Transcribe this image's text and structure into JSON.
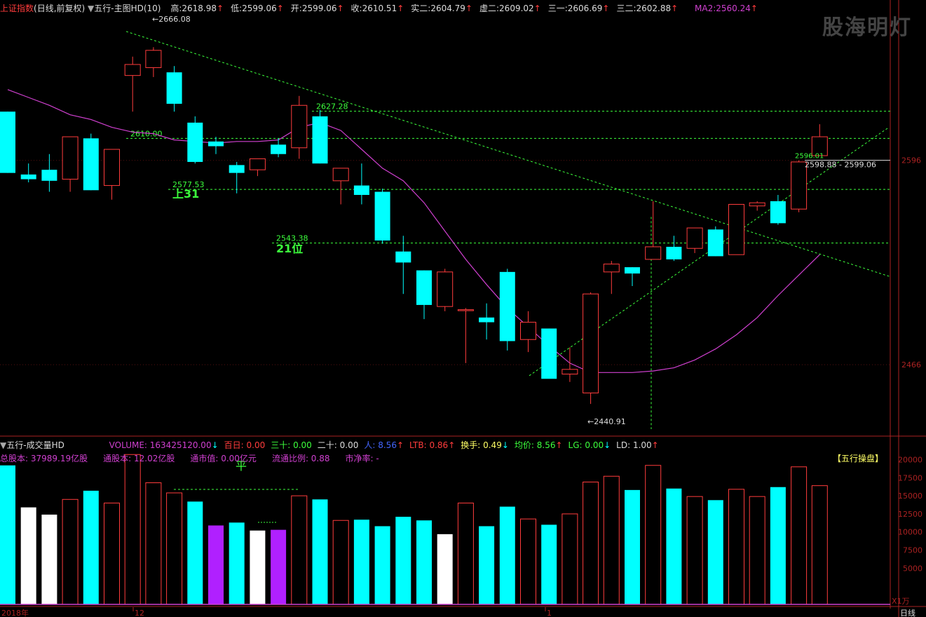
{
  "colors": {
    "up": "#ff3c3c",
    "down": "#00ffff",
    "ma": "#d040d0",
    "guide": "#3cff3c",
    "white": "#ffffff",
    "purple": "#b020ff",
    "axis": "#aa2222"
  },
  "header": {
    "index_name": "上证指数",
    "mode": "(日线,前复权)",
    "indicator": "五行-主图HD(10)",
    "quotes": [
      {
        "label": "高:",
        "value": "2618.98"
      },
      {
        "label": "低:",
        "value": "2599.06"
      },
      {
        "label": "开:",
        "value": "2599.06"
      },
      {
        "label": "收:",
        "value": "2610.51"
      },
      {
        "label": "实二:",
        "value": "2604.79"
      },
      {
        "label": "虚二:",
        "value": "2609.02"
      },
      {
        "label": "三一:",
        "value": "2606.69"
      },
      {
        "label": "三二:",
        "value": "2602.88"
      }
    ],
    "ma2_label": "MA2:",
    "ma2_value": "2560.24"
  },
  "watermark": "股海明灯",
  "annotations": {
    "top_high": "2666.08",
    "low_point": "2440.91",
    "level_2610": "2610.00",
    "level_2627": "2627.28",
    "level_2577": "2577.53",
    "level_2543": "2543.38",
    "tag_up31": "上31",
    "tag_21": "21位",
    "last_price": "2596.01",
    "last_range": "2598.88 - 2599.06"
  },
  "price_axis": [
    "2596",
    "2466"
  ],
  "volume_header": {
    "title": "五行-成交量HD",
    "items": [
      {
        "label": "VOLUME: ",
        "value": "163425120.00",
        "arrow": "↓"
      },
      {
        "label": "百日: ",
        "value": "0.00",
        "arrow": ""
      },
      {
        "label": "三十: ",
        "value": "0.00",
        "arrow": ""
      },
      {
        "label": "二十: ",
        "value": "0.00",
        "arrow": ""
      },
      {
        "label": "人: ",
        "value": "8.56",
        "arrow": "↑"
      },
      {
        "label": "LTB: ",
        "value": "0.86",
        "arrow": "↑"
      },
      {
        "label": "换手: ",
        "value": "0.49",
        "arrow": "↓"
      },
      {
        "label": "均价: ",
        "value": "8.56",
        "arrow": "↑"
      },
      {
        "label": "LG: ",
        "value": "0.00",
        "arrow": "↓"
      },
      {
        "label": "LD: ",
        "value": "1.00",
        "arrow": "↑"
      }
    ],
    "line2": [
      {
        "label": "总股本: ",
        "value": "37989.19亿股"
      },
      {
        "label": "通股本: ",
        "value": "12.02亿股"
      },
      {
        "label": "通市值: ",
        "value": "0.00亿元"
      },
      {
        "label": "流通比例: ",
        "value": "0.88"
      },
      {
        "label": "市净率: ",
        "value": "-"
      }
    ],
    "flat_tag": "平",
    "badge": "【五行操盘】"
  },
  "volume_axis": [
    "20000",
    "17500",
    "15000",
    "12500",
    "10000",
    "7500",
    "5000"
  ],
  "volume_unit": "X1万",
  "date_labels": [
    "2018年",
    "12",
    "1"
  ],
  "period": "日线",
  "chart_data": [
    {
      "type": "candlestick",
      "title": "上证指数 (日线,前复权)",
      "xlabel": "",
      "ylabel": "",
      "ylim": [
        2425,
        2690
      ],
      "candles": [
        {
          "o": 2627,
          "h": 2627,
          "l": 2588,
          "c": 2588,
          "dir": "down"
        },
        {
          "o": 2587,
          "h": 2594,
          "l": 2582,
          "c": 2584,
          "dir": "down"
        },
        {
          "o": 2590,
          "h": 2600,
          "l": 2576,
          "c": 2583,
          "dir": "down"
        },
        {
          "o": 2584,
          "h": 2610,
          "l": 2576,
          "c": 2611,
          "dir": "up"
        },
        {
          "o": 2610,
          "h": 2613,
          "l": 2577,
          "c": 2577,
          "dir": "down"
        },
        {
          "o": 2580,
          "h": 2595,
          "l": 2571,
          "c": 2603,
          "dir": "up"
        },
        {
          "o": 2650,
          "h": 2662,
          "l": 2627,
          "c": 2657,
          "dir": "up"
        },
        {
          "o": 2655,
          "h": 2668,
          "l": 2649,
          "c": 2666,
          "dir": "up"
        },
        {
          "o": 2652,
          "h": 2656,
          "l": 2627,
          "c": 2632,
          "dir": "down"
        },
        {
          "o": 2620,
          "h": 2624,
          "l": 2594,
          "c": 2595,
          "dir": "down"
        },
        {
          "o": 2608,
          "h": 2611,
          "l": 2600,
          "c": 2605,
          "dir": "down"
        },
        {
          "o": 2593,
          "h": 2595,
          "l": 2575,
          "c": 2588,
          "dir": "down"
        },
        {
          "o": 2590,
          "h": 2597,
          "l": 2586,
          "c": 2597,
          "dir": "up"
        },
        {
          "o": 2606,
          "h": 2610,
          "l": 2598,
          "c": 2600,
          "dir": "down"
        },
        {
          "o": 2604,
          "h": 2637,
          "l": 2597,
          "c": 2631,
          "dir": "up"
        },
        {
          "o": 2624,
          "h": 2628,
          "l": 2594,
          "c": 2594,
          "dir": "down"
        },
        {
          "o": 2591,
          "h": 2591,
          "l": 2568,
          "c": 2583,
          "dir": "up"
        },
        {
          "o": 2580,
          "h": 2594,
          "l": 2568,
          "c": 2574,
          "dir": "down"
        },
        {
          "o": 2576,
          "h": 2578,
          "l": 2543,
          "c": 2545,
          "dir": "down"
        },
        {
          "o": 2538,
          "h": 2548,
          "l": 2511,
          "c": 2531,
          "dir": "down"
        },
        {
          "o": 2526,
          "h": 2526,
          "l": 2495,
          "c": 2504,
          "dir": "down"
        },
        {
          "o": 2503,
          "h": 2527,
          "l": 2500,
          "c": 2525,
          "dir": "up"
        },
        {
          "o": 2501,
          "h": 2502,
          "l": 2467,
          "c": 2501,
          "dir": "up"
        },
        {
          "o": 2496,
          "h": 2505,
          "l": 2482,
          "c": 2493,
          "dir": "down"
        },
        {
          "o": 2525,
          "h": 2527,
          "l": 2475,
          "c": 2481,
          "dir": "down"
        },
        {
          "o": 2482,
          "h": 2500,
          "l": 2474,
          "c": 2493,
          "dir": "up"
        },
        {
          "o": 2489,
          "h": 2489,
          "l": 2462,
          "c": 2457,
          "dir": "down"
        },
        {
          "o": 2460,
          "h": 2477,
          "l": 2455,
          "c": 2463,
          "dir": "up"
        },
        {
          "o": 2448,
          "h": 2512,
          "l": 2441,
          "c": 2511,
          "dir": "up"
        },
        {
          "o": 2525,
          "h": 2532,
          "l": 2511,
          "c": 2530,
          "dir": "up"
        },
        {
          "o": 2524,
          "h": 2528,
          "l": 2516,
          "c": 2528,
          "dir": "down"
        },
        {
          "o": 2533,
          "h": 2570,
          "l": 2533,
          "c": 2541,
          "dir": "up"
        },
        {
          "o": 2541,
          "h": 2548,
          "l": 2532,
          "c": 2533,
          "dir": "down"
        },
        {
          "o": 2540,
          "h": 2553,
          "l": 2537,
          "c": 2553,
          "dir": "up"
        },
        {
          "o": 2552,
          "h": 2554,
          "l": 2535,
          "c": 2535,
          "dir": "down"
        },
        {
          "o": 2536,
          "h": 2568,
          "l": 2536,
          "c": 2568,
          "dir": "up"
        },
        {
          "o": 2567,
          "h": 2570,
          "l": 2564,
          "c": 2569,
          "dir": "up"
        },
        {
          "o": 2570,
          "h": 2574,
          "l": 2555,
          "c": 2556,
          "dir": "down"
        },
        {
          "o": 2565,
          "h": 2596,
          "l": 2563,
          "c": 2595,
          "dir": "up"
        },
        {
          "o": 2599,
          "h": 2619,
          "l": 2599,
          "c": 2611,
          "dir": "up"
        }
      ],
      "ma2": [
        2641,
        2636,
        2631,
        2625,
        2622,
        2617,
        2614,
        2613,
        2609,
        2608,
        2607,
        2608,
        2608,
        2609,
        2617,
        2620,
        2615,
        2603,
        2591,
        2583,
        2569,
        2551,
        2533,
        2517,
        2502,
        2490,
        2478,
        2467,
        2461,
        2461,
        2461,
        2462,
        2464,
        2469,
        2476,
        2485,
        2496,
        2510,
        2523,
        2536
      ],
      "levels": [
        2610.0,
        2627.28,
        2577.53,
        2543.38,
        2596.01
      ]
    },
    {
      "type": "bar",
      "title": "五行-成交量HD",
      "ylabel": "X1万",
      "ylim": [
        0,
        21500
      ],
      "values": [
        19200,
        13400,
        12400,
        14500,
        15700,
        14000,
        20700,
        16800,
        15400,
        14200,
        10900,
        11300,
        10200,
        10300,
        15000,
        14500,
        11600,
        11700,
        10800,
        12100,
        11600,
        9700,
        14000,
        10800,
        13500,
        11800,
        11000,
        12500,
        16900,
        17700,
        15800,
        19200,
        16000,
        14900,
        14400,
        15900,
        14900,
        16200,
        19000,
        16400
      ],
      "colors": [
        "cyan",
        "white",
        "white",
        "up",
        "cyan",
        "up",
        "up",
        "up",
        "up",
        "cyan",
        "purple",
        "cyan",
        "white",
        "purple",
        "up",
        "cyan",
        "up",
        "cyan",
        "cyan",
        "cyan",
        "cyan",
        "white",
        "up",
        "cyan",
        "cyan",
        "up",
        "cyan",
        "up",
        "up",
        "up",
        "cyan",
        "up",
        "cyan",
        "up",
        "cyan",
        "up",
        "up",
        "cyan",
        "up",
        "up"
      ]
    }
  ]
}
